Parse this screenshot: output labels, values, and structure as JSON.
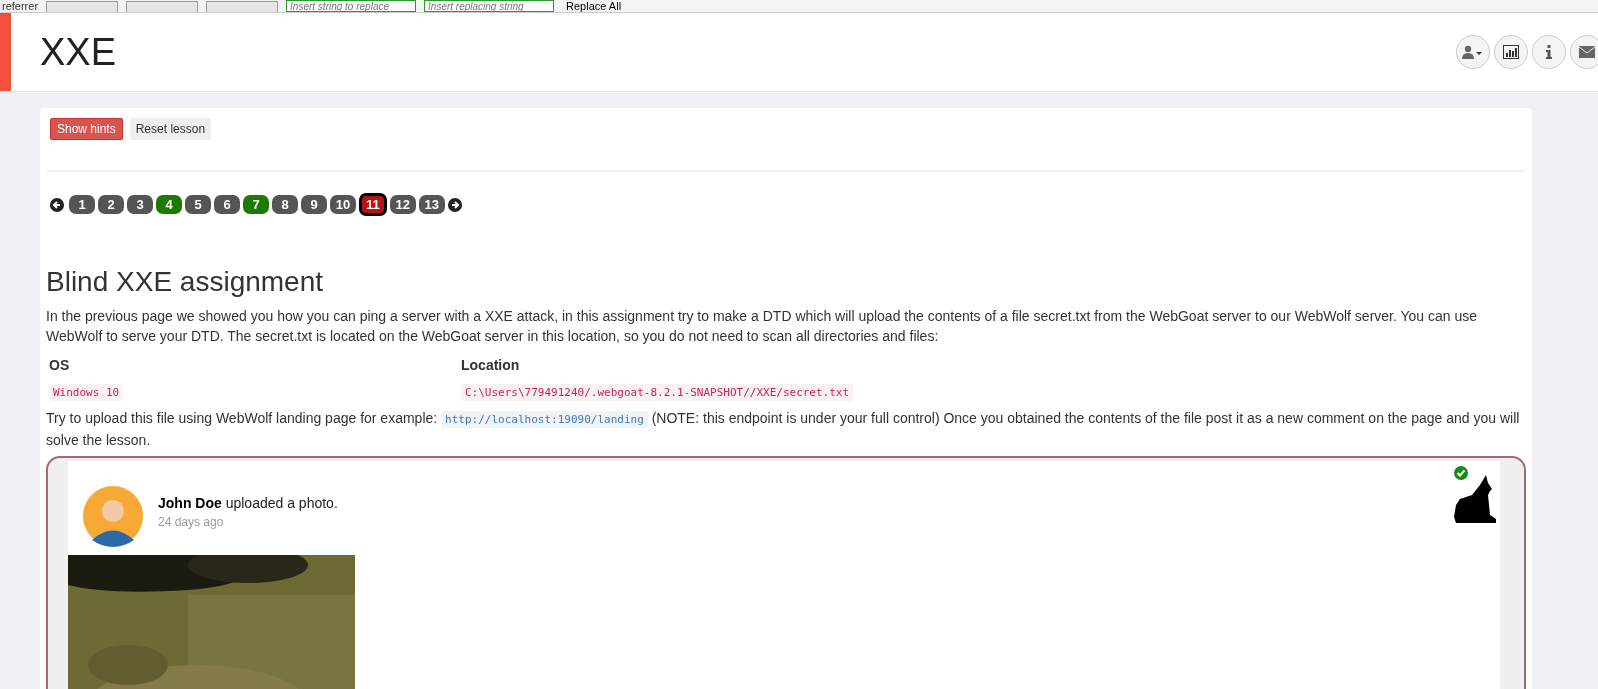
{
  "toolbar": {
    "label": "referrer",
    "search_placeholder": "Insert string to replace",
    "replace_placeholder": "Insert replacing string",
    "replace_all": "Replace All"
  },
  "header": {
    "title": "XXE"
  },
  "lesson_buttons": [
    {
      "label": "Show hints",
      "kind": "primary"
    },
    {
      "label": "Reset lesson",
      "kind": "plain"
    }
  ],
  "pages": [
    {
      "label": "1",
      "solved": false,
      "selected": false
    },
    {
      "label": "2",
      "solved": false,
      "selected": false
    },
    {
      "label": "3",
      "solved": false,
      "selected": false
    },
    {
      "label": "4",
      "solved": true,
      "selected": false
    },
    {
      "label": "5",
      "solved": false,
      "selected": false
    },
    {
      "label": "6",
      "solved": false,
      "selected": false
    },
    {
      "label": "7",
      "solved": true,
      "selected": false
    },
    {
      "label": "8",
      "solved": false,
      "selected": false
    },
    {
      "label": "9",
      "solved": false,
      "selected": false
    },
    {
      "label": "10",
      "solved": false,
      "selected": false
    },
    {
      "label": "11",
      "solved": false,
      "selected": true
    },
    {
      "label": "12",
      "solved": false,
      "selected": false
    },
    {
      "label": "13",
      "solved": false,
      "selected": false
    }
  ],
  "assignment": {
    "title": "Blind XXE assignment",
    "intro": "In the previous page we showed you how you can ping a server with a XXE attack, in this assignment try to make a DTD which will upload the contents of a file secret.txt from the WebGoat server to our WebWolf server. You can use WebWolf to serve your DTD. The secret.txt is located on the WebGoat server in this location, so you do not need to scan all directories and files:",
    "table": {
      "columns": [
        "OS",
        "Location"
      ],
      "rows": [
        [
          "Windows 10",
          "C:\\Users\\779491240/.webgoat-8.2.1-SNAPSHOT//XXE/secret.txt"
        ]
      ]
    },
    "note_before": "Try to upload this file using WebWolf landing page for example:",
    "note_link": "http://localhost:19090/landing",
    "note_after": "(NOTE: this endpoint is under your full control) Once you obtained the contents of the file post it as a new comment on the page and you will solve the lesson.",
    "solved": true
  },
  "post": {
    "author": "John Doe",
    "action": "uploaded a photo.",
    "time": "24 days ago"
  }
}
